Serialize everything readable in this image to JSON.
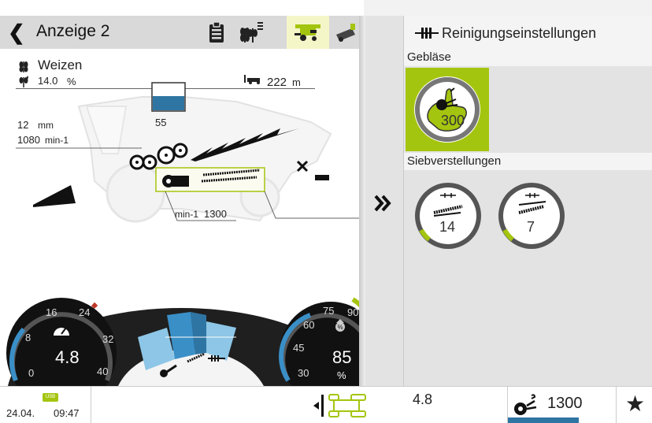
{
  "screen": {
    "title": "Anzeige 2",
    "tabs": [
      {
        "name": "clipboard-icon",
        "active": false
      },
      {
        "name": "crop-settings-icon",
        "active": false
      },
      {
        "name": "combine-icon",
        "active": true
      },
      {
        "name": "tool-icon",
        "active": false
      }
    ]
  },
  "machine": {
    "crop": "Weizen",
    "moisture_value": "14.0",
    "moisture_unit": "%",
    "distance_value": "222",
    "distance_unit": "m",
    "tank_level": "55",
    "gap_value": "12",
    "gap_unit": "mm",
    "drum_speed_value": "1080",
    "drum_speed_unit": "min-1",
    "fan_speed_unit": "min-1",
    "fan_speed_value": "1300"
  },
  "gauges": {
    "speed": {
      "value": "4.8",
      "ticks": [
        "8",
        "16",
        "24",
        "32",
        "40",
        "0"
      ]
    },
    "load": {
      "value": "85",
      "unit": "%",
      "ticks": [
        "75",
        "90",
        "60",
        "45",
        "30"
      ]
    }
  },
  "right_panel": {
    "title": "Reinigungseinstellungen",
    "section_fan": "Gebläse",
    "fan_value": "300",
    "section_sieves": "Siebverstellungen",
    "sieve_upper": "14",
    "sieve_lower": "7"
  },
  "status_bar": {
    "date": "24.04.",
    "time": "09:47",
    "speed": "4.8",
    "fan_speed": "1300",
    "usb_label": "USB"
  },
  "colors": {
    "accent": "#a4c50f",
    "tank_fill": "#2f75a3",
    "gauge_blue": "#3a8fc7",
    "gauge_light": "#8dc6e6",
    "dark": "#1c1c1c"
  }
}
